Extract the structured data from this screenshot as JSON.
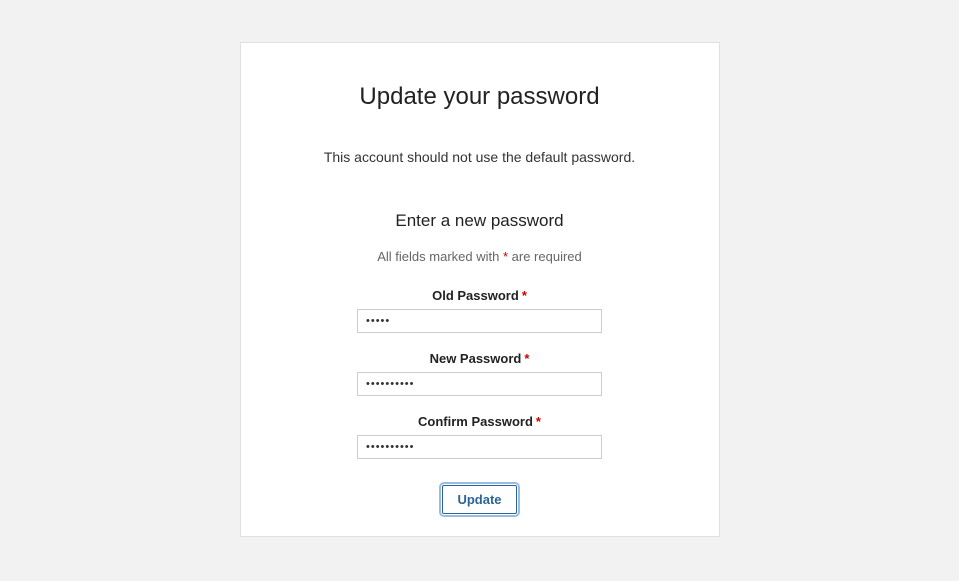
{
  "title": "Update your password",
  "subtitle": "This account should not use the default password.",
  "section_title": "Enter a new password",
  "required_note_prefix": "All fields marked with ",
  "required_note_star": "*",
  "required_note_suffix": " are required",
  "fields": {
    "old_password": {
      "label": "Old Password",
      "value": "•••••"
    },
    "new_password": {
      "label": "New Password",
      "value": "••••••••••"
    },
    "confirm_password": {
      "label": "Confirm Password",
      "value": "••••••••••"
    }
  },
  "star": "*",
  "update_button": "Update"
}
